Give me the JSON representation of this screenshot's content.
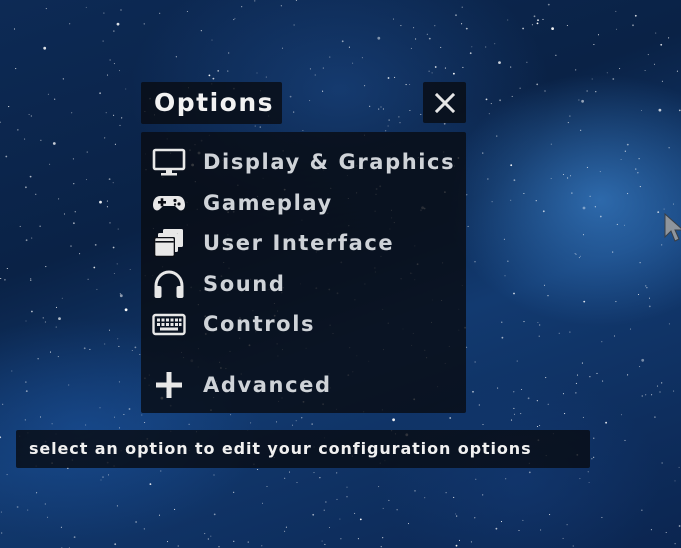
{
  "options_menu": {
    "title": "Options",
    "close_icon": "close-x-icon",
    "items": [
      {
        "label": "Display & Graphics",
        "icon": "monitor-icon"
      },
      {
        "label": "Gameplay",
        "icon": "gamepad-icon"
      },
      {
        "label": "User Interface",
        "icon": "windows-stack-icon"
      },
      {
        "label": "Sound",
        "icon": "headphones-icon"
      },
      {
        "label": "Controls",
        "icon": "keyboard-icon"
      },
      {
        "label": "Advanced",
        "icon": "plus-icon"
      }
    ]
  },
  "hint": "select an option to edit your configuration options",
  "colors": {
    "panel_background": "#080c14",
    "label_text": "#cfd3d8",
    "title_text": "#f2f2f2",
    "space_background": "#0a2246"
  }
}
